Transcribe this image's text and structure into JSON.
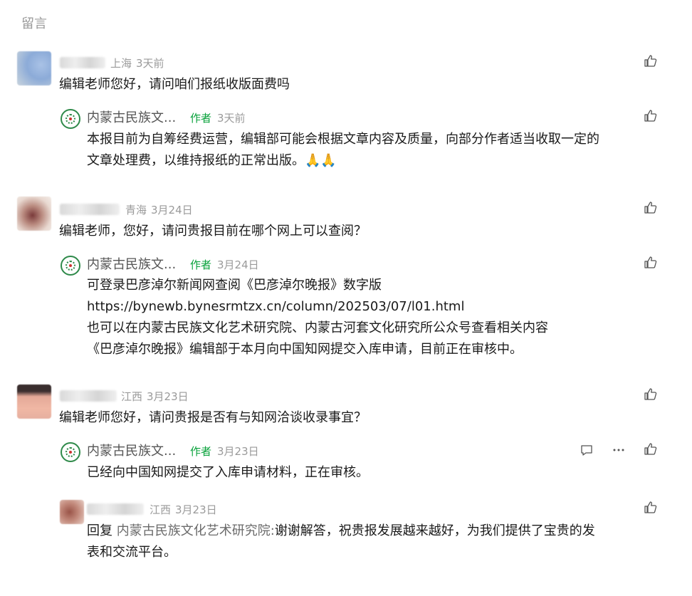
{
  "section_title": "留言",
  "comments": [
    {
      "location": "上海",
      "time": "3天前",
      "text": "编辑老师您好，请问咱们报纸收版面费吗",
      "reply": {
        "name": "内蒙古民族文...",
        "tag": "作者",
        "time": "3天前",
        "lines": [
          "本报目前为自筹经费运营，编辑部可能会根据文章内容及质量，向部分作者适当收取一定的",
          "文章处理费，以维持报纸的正常出版。🙏🙏"
        ]
      }
    },
    {
      "location": "青海",
      "time": "3月24日",
      "text": "编辑老师，您好，请问贵报目前在哪个网上可以查阅？",
      "reply": {
        "name": "内蒙古民族文...",
        "tag": "作者",
        "time": "3月24日",
        "lines": [
          "可登录巴彦淖尔新闻网查阅《巴彦淖尔晚报》数字版",
          "https://bynewb.bynesrmtzx.cn/column/202503/07/l01.html",
          "也可以在内蒙古民族文化艺术研究院、内蒙古河套文化研究所公众号查看相关内容",
          "《巴彦淖尔晚报》编辑部于本月向中国知网提交入库申请，目前正在审核中。"
        ]
      }
    },
    {
      "location": "江西",
      "time": "3月23日",
      "text": "编辑老师您好，请问贵报是否有与知网洽谈收录事宜？",
      "reply": {
        "name": "内蒙古民族文...",
        "tag": "作者",
        "time": "3月23日",
        "lines": [
          "已经向中国知网提交了入库申请材料，正在审核。"
        ]
      },
      "sub_reply": {
        "location": "江西",
        "time": "3月23日",
        "prefix": "回复 ",
        "target": "内蒙古民族文化艺术研究院:",
        "lines": [
          "谢谢解答，祝贵报发展越来越好，为我们提供了宝贵的发",
          "表和交流平台。"
        ]
      }
    }
  ],
  "icons": {
    "like": "thumbs-up-icon",
    "comment": "comment-icon",
    "more": "more-icon"
  }
}
